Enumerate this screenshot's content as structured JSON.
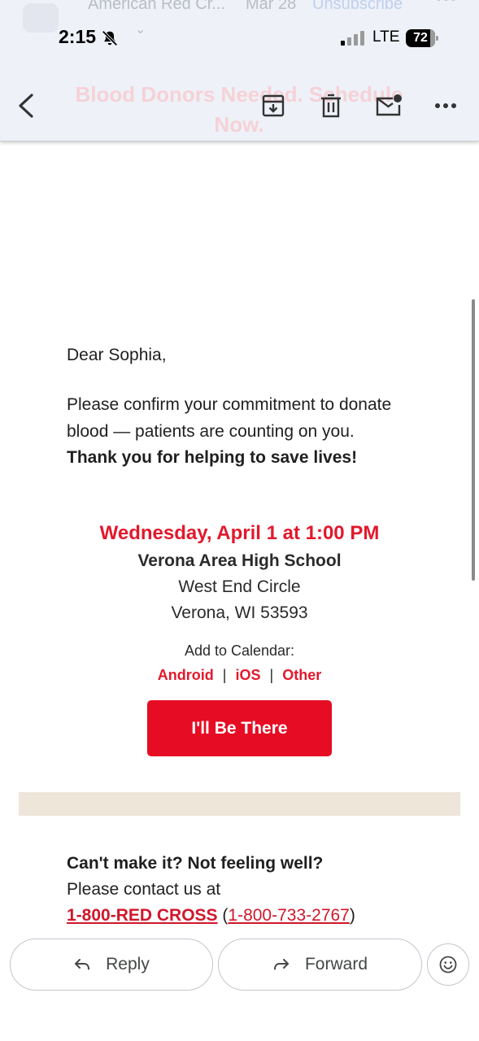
{
  "status_bar": {
    "time": "2:15",
    "network": "LTE",
    "battery": "72",
    "battery_level_percent": 72
  },
  "background_header": {
    "sender": "American Red Cr...",
    "date": "Mar 28",
    "unsubscribe": "Unsubscribe",
    "subject": "Blood Donors Needed. Schedule Now."
  },
  "toolbar": {
    "icons": [
      "back-arrow-icon",
      "archive-icon",
      "trash-icon",
      "mark-unread-icon",
      "more-icon"
    ]
  },
  "email": {
    "greeting": "Dear Sophia,",
    "intro_text": "Please confirm your commitment to donate blood — patients are counting on you.",
    "intro_bold": "Thank you for helping to save lives!",
    "event_datetime": "Wednesday, April 1 at 1:00 PM",
    "venue": "Verona Area High School",
    "street": "West End Circle",
    "city": "Verona, WI 53593",
    "calendar_label": "Add to Calendar:",
    "calendar_links": [
      "Android",
      "iOS",
      "Other"
    ],
    "calendar_separator": "|",
    "cta_label": "I'll Be There",
    "cant_make_it": "Can't make it? Not feeling well?",
    "contact_text": "Please contact us at",
    "phone_vanity": "1-800-RED CROSS",
    "phone_open": "(",
    "phone_number": "1-800-733-2767",
    "phone_close": ")"
  },
  "actions": {
    "reply": "Reply",
    "forward": "Forward"
  },
  "colors": {
    "brand_red": "#e60c23",
    "link_red": "#d0172b",
    "divider_beige": "#ede6d9",
    "header_bg": "#eef1f8"
  }
}
